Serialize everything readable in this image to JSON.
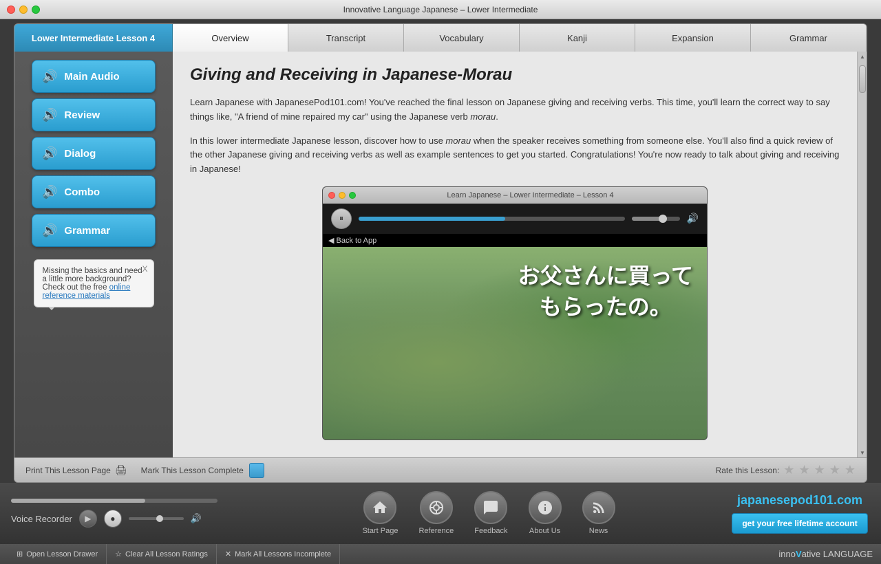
{
  "titlebar": {
    "title": "Innovative Language Japanese – Lower Intermediate"
  },
  "lesson": {
    "title": "Lower Intermediate Lesson 4",
    "heading": "Giving and Receiving in Japanese-Morau",
    "paragraph1": "Learn Japanese with JapanesePod101.com! You've reached the final lesson on Japanese giving and receiving verbs. This time, you'll learn the correct way to say things like, \"A friend of mine repaired my car\" using the Japanese verb morau.",
    "paragraph2": "In this lower intermediate Japanese lesson, discover how to use morau when the speaker receives something from someone else. You'll also find a quick review of the other Japanese giving and receiving verbs as well as example sentences to get you started. Congratulations! You're now ready to talk about giving and receiving in Japanese!"
  },
  "tabs": [
    {
      "label": "Overview",
      "active": true
    },
    {
      "label": "Transcript",
      "active": false
    },
    {
      "label": "Vocabulary",
      "active": false
    },
    {
      "label": "Kanji",
      "active": false
    },
    {
      "label": "Expansion",
      "active": false
    },
    {
      "label": "Grammar",
      "active": false
    }
  ],
  "sidebar": {
    "buttons": [
      {
        "label": "Main Audio",
        "id": "main-audio"
      },
      {
        "label": "Review",
        "id": "review"
      },
      {
        "label": "Dialog",
        "id": "dialog"
      },
      {
        "label": "Combo",
        "id": "combo"
      },
      {
        "label": "Grammar",
        "id": "grammar"
      }
    ],
    "infobox": {
      "text": "Missing the basics and need a little more background? Check out the free ",
      "link": "online reference materials",
      "close": "X"
    }
  },
  "player": {
    "title": "Learn Japanese – Lower Intermediate – Lesson 4",
    "back_label": "◀ Back to App",
    "japanese_text": "お父さんに買って\nもらったの。"
  },
  "status_bar": {
    "print_label": "Print This Lesson Page",
    "mark_complete_label": "Mark This Lesson Complete",
    "rate_label": "Rate this Lesson:"
  },
  "footer": {
    "voice_recorder": "Voice Recorder",
    "nav_items": [
      {
        "icon": "🏠",
        "label": "Start Page",
        "icon_name": "home-icon"
      },
      {
        "icon": "◎",
        "label": "Reference",
        "icon_name": "reference-icon"
      },
      {
        "icon": "💬",
        "label": "Feedback",
        "icon_name": "feedback-icon"
      },
      {
        "icon": "ℹ",
        "label": "About Us",
        "icon_name": "about-icon"
      },
      {
        "icon": "📡",
        "label": "News",
        "icon_name": "news-icon"
      }
    ],
    "brand": "japanesepod101.com",
    "cta": "get your free lifetime account"
  },
  "toolbar": {
    "items": [
      {
        "icon": "⊞",
        "label": "Open Lesson Drawer"
      },
      {
        "icon": "☆",
        "label": "Clear All Lesson Ratings"
      },
      {
        "icon": "✕",
        "label": "Mark All Lessons Incomplete"
      }
    ],
    "brand": "inno"
  }
}
